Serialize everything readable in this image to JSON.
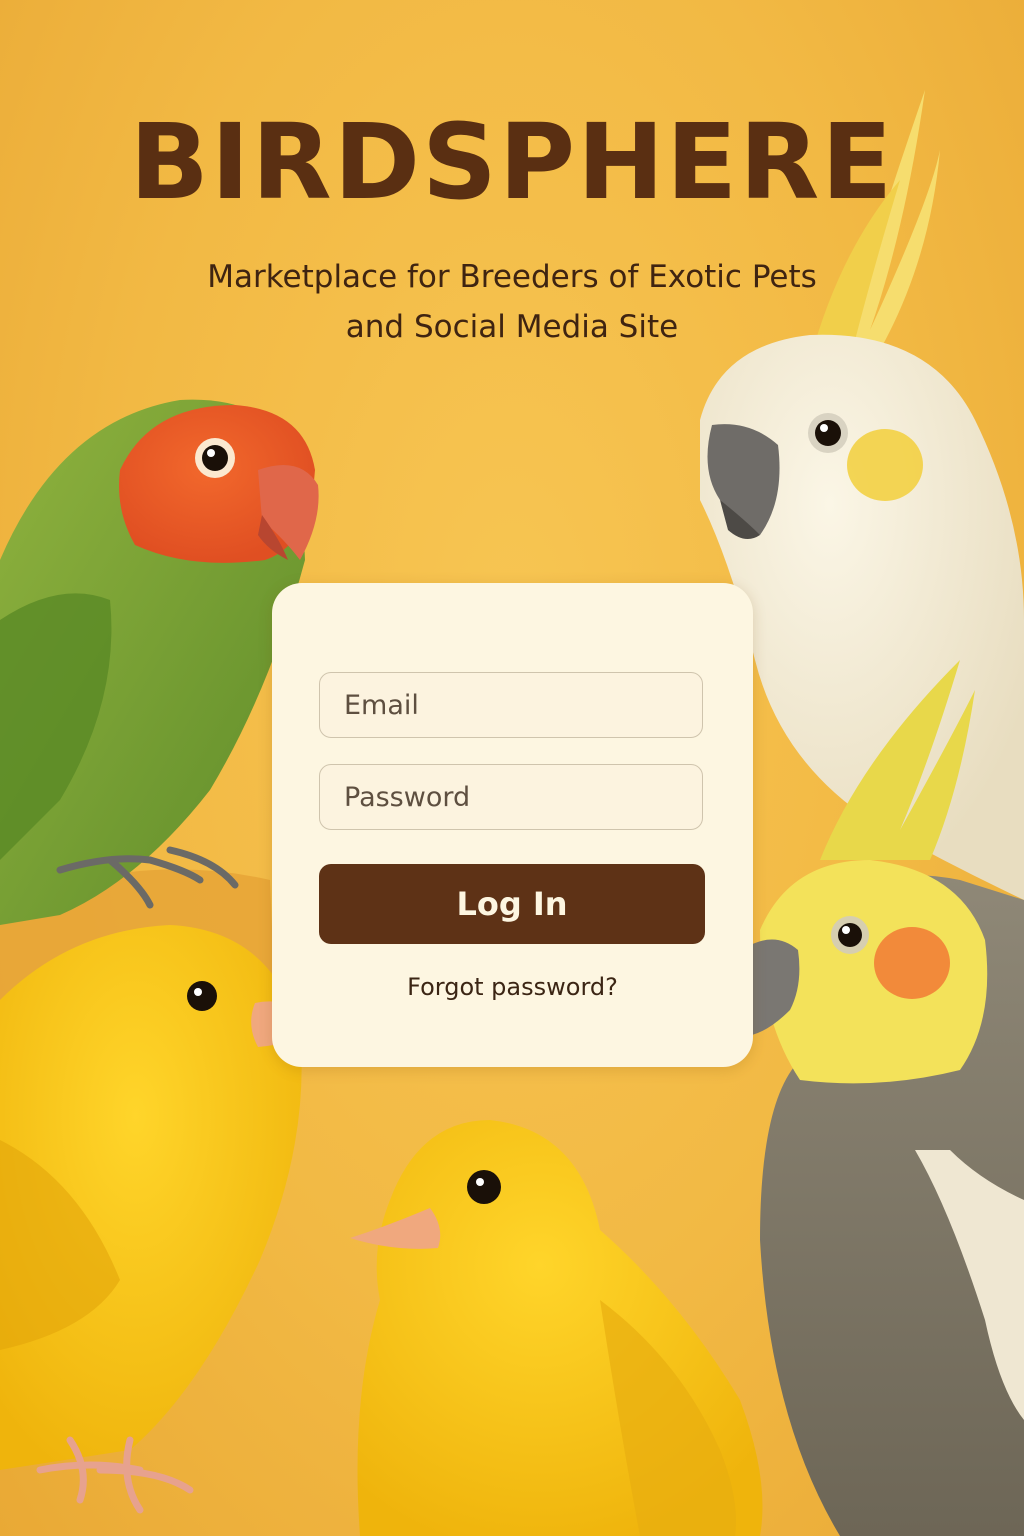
{
  "brand": {
    "title": "BIRDSPHERE",
    "subtitle_line1": "Marketplace for Breeders of Exotic Pets",
    "subtitle_line2": "and Social Media Site"
  },
  "login": {
    "email_placeholder": "Email",
    "password_placeholder": "Password",
    "login_label": "Log In",
    "forgot_label": "Forgot password?"
  },
  "illustration": {
    "birds": [
      "lovebird",
      "cockatoo",
      "cockatiel",
      "canary-left",
      "canary-center"
    ]
  },
  "colors": {
    "background": "#f2b944",
    "title": "#5a2f12",
    "card": "#fdf6e1",
    "button": "#5e3216"
  }
}
